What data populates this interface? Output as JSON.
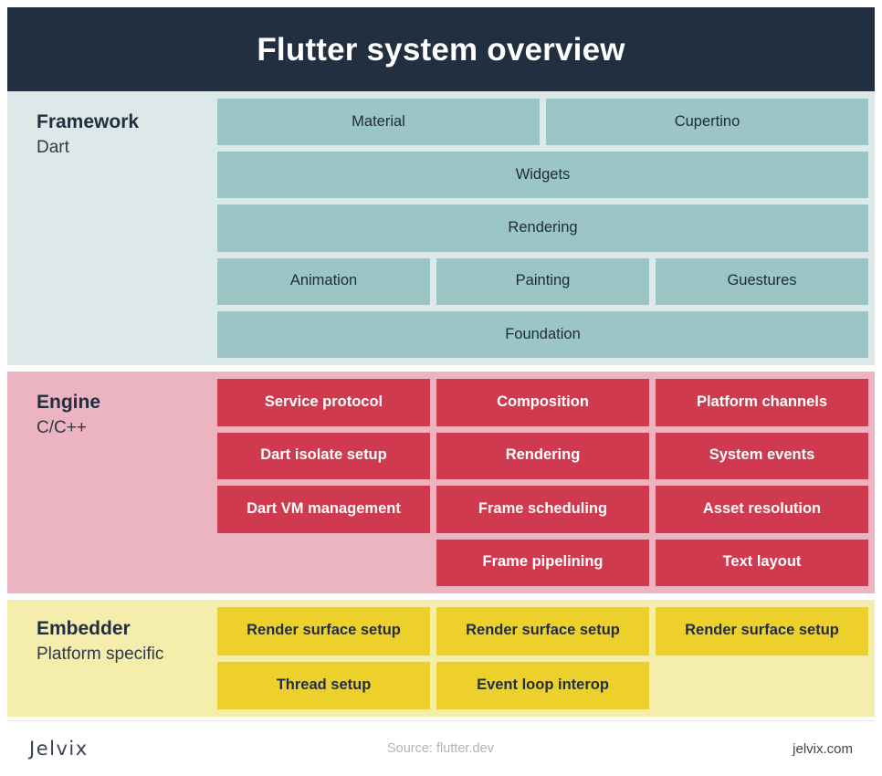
{
  "header": {
    "title": "Flutter system overview",
    "background": "#222f40",
    "text_color": "#ffffff"
  },
  "sections": [
    {
      "id": "framework",
      "title": "Framework",
      "subtitle": "Dart",
      "band_color": "#dde9e8",
      "cell_color": "#9cc6c6",
      "rows": [
        [
          "Material",
          "Cupertino"
        ],
        [
          "Widgets"
        ],
        [
          "Rendering"
        ],
        [
          "Animation",
          "Painting",
          "Guestures"
        ],
        [
          "Foundation"
        ]
      ]
    },
    {
      "id": "engine",
      "title": "Engine",
      "subtitle": "C/C++",
      "band_color": "#ecb3c1",
      "cell_color": "#cf3a4e",
      "rows": [
        [
          "Service protocol",
          "Composition",
          "Platform channels"
        ],
        [
          "Dart isolate setup",
          "Rendering",
          "System events"
        ],
        [
          "Dart VM management",
          "Frame scheduling",
          "Asset resolution"
        ],
        [
          "",
          "Frame pipelining",
          "Text layout"
        ]
      ]
    },
    {
      "id": "embedder",
      "title": "Embedder",
      "subtitle": "Platform specific",
      "band_color": "#f5edac",
      "cell_color": "#eed02c",
      "rows": [
        [
          "Render surface setup",
          "Render surface setup",
          "Render surface setup"
        ],
        [
          "Thread setup",
          "Event loop interop",
          ""
        ]
      ]
    }
  ],
  "footer": {
    "logo": "Jelvix",
    "source": "Source: flutter.dev",
    "site": "jelvix.com"
  }
}
